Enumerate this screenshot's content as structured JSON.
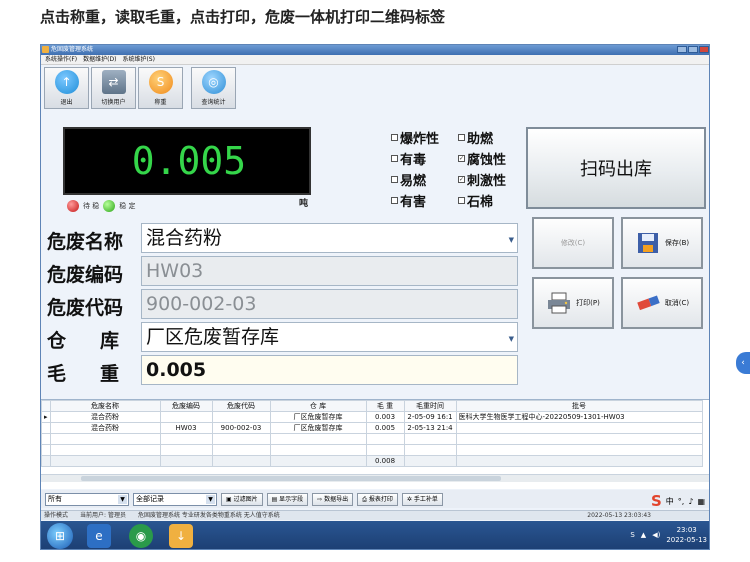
{
  "caption": "点击称重，读取毛重，点击打印，危废一体机打印二维码标签",
  "window": {
    "title": "危固废管理系统"
  },
  "menu": [
    "系统操作(F)",
    "数据维护(D)",
    "系统维护(S)"
  ],
  "toolbar": [
    {
      "label": "退出",
      "icon": "exit-icon",
      "color": "#1f8ed8"
    },
    {
      "label": "切换用户",
      "icon": "switch-user-icon",
      "color": "#6b7f93"
    },
    {
      "label": "称重",
      "icon": "weigh-icon",
      "color": "#f2a12a"
    },
    {
      "label": "查询统计",
      "icon": "query-stats-icon",
      "color": "#2f8fd6"
    }
  ],
  "scale": {
    "value": "0.005",
    "unit": "吨",
    "status_left": "待 稳",
    "status_right": "稳 定"
  },
  "properties": [
    {
      "label": "爆炸性",
      "checked": false
    },
    {
      "label": "助燃",
      "checked": false
    },
    {
      "label": "有毒",
      "checked": false
    },
    {
      "label": "腐蚀性",
      "checked": true
    },
    {
      "label": "易燃",
      "checked": false
    },
    {
      "label": "刺激性",
      "checked": true
    },
    {
      "label": "有害",
      "checked": false
    },
    {
      "label": "石棉",
      "checked": false
    }
  ],
  "scan_button": "扫码出库",
  "fields": {
    "name_label": "危废名称",
    "name_value": "混合药粉",
    "code_label": "危废编码",
    "code_value": "HW03",
    "dcode_label": "危废代码",
    "dcode_value": "900-002-03",
    "warehouse_label_1": "仓",
    "warehouse_label_2": "库",
    "warehouse_value": "厂区危废暂存库",
    "gross_label_1": "毛",
    "gross_label_2": "重",
    "gross_value": "0.005"
  },
  "actions": {
    "modify": "修改(C)",
    "save": "保存(B)",
    "print": "打印(P)",
    "cancel": "取消(C)"
  },
  "table": {
    "headers": [
      "危废名称",
      "危废编码",
      "危废代码",
      "仓 库",
      "毛 重",
      "毛重时间",
      "批号"
    ],
    "rows": [
      [
        "混合药粉",
        "",
        "",
        "厂区危废暂存库",
        "0.003",
        "2-05-09 16:1",
        "医科大学生物医学工程中心-20220509-1301-HW03"
      ],
      [
        "混合药粉",
        "HW03",
        "900-002-03",
        "厂区危废暂存库",
        "0.005",
        "2-05-13 21:4",
        ""
      ]
    ],
    "total": "0.008"
  },
  "bottom": {
    "filter1": "所有",
    "filter2": "全部记录",
    "buttons": [
      "过滤图片",
      "显示字段",
      "数据导出",
      "报表打印",
      "手工补单"
    ],
    "ime": "中"
  },
  "status": {
    "left": "操作模式",
    "user": "当前用户: 管理员",
    "system": "危固废管理系统 专业研发各类物重系统 无人值守系统",
    "datetime": "2022-05-13 23:03:43"
  },
  "taskbar": {
    "time": "23:03",
    "date": "2022-05-13"
  }
}
